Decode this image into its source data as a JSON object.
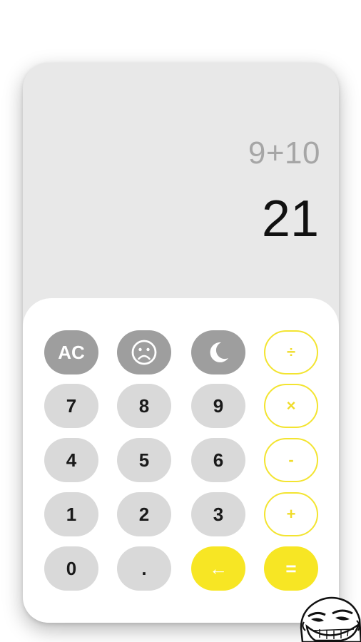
{
  "display": {
    "expression": "9+10",
    "result": "21"
  },
  "keypad": {
    "row1": {
      "clear_label": "AC",
      "sad_icon": "sad-face-icon",
      "theme_icon": "moon-icon",
      "divide_label": "÷"
    },
    "row2": {
      "k7": "7",
      "k8": "8",
      "k9": "9",
      "multiply_label": "×"
    },
    "row3": {
      "k4": "4",
      "k5": "5",
      "k6": "6",
      "minus_label": "-"
    },
    "row4": {
      "k1": "1",
      "k2": "2",
      "k3": "3",
      "plus_label": "+"
    },
    "row5": {
      "k0": "0",
      "decimal_label": ".",
      "backspace_label": "←",
      "equals_label": "="
    }
  },
  "colors": {
    "accent_yellow": "#f7e624",
    "function_gray": "#9e9e9e",
    "number_gray": "#d9d9d9",
    "display_bg": "#e8e8e8"
  }
}
